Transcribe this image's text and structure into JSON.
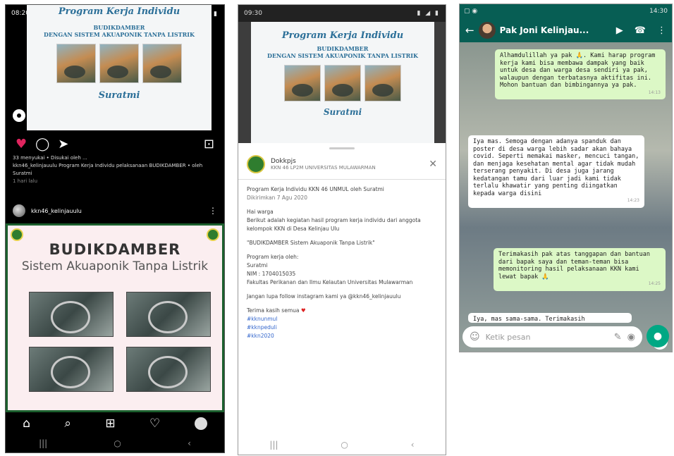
{
  "instagram": {
    "status_bar": {
      "time": "08:20",
      "right": "▮ ⌔ ◢ ▮"
    },
    "post_top": {
      "title": "Program Kerja Individu",
      "line1": "BUDIKDAMBER",
      "line2": "DENGAN SISTEM AKUAPONIK TANPA LISTRIK",
      "name": "Suratmi"
    },
    "likes_text": "33 menyukai • Disukai oleh ...",
    "caption_text": "kkn46_kelinjauulu Program Kerja Individu pelaksanaan BUDIKDAMBER • oleh Suratmi",
    "date_text": "1 hari lalu",
    "username": "kkn46_kelinjauulu",
    "post_bottom": {
      "title": "BUDIKDAMBER",
      "subtitle": "Sistem Akuaponik Tanpa Listrik"
    },
    "icons": {
      "heart": "♥",
      "comment": "◯",
      "share": "➤",
      "save": "⊡",
      "home": "⌂",
      "search": "⌕",
      "add": "⊞",
      "activity": "♡",
      "sys_recent": "|||",
      "sys_home": "○",
      "sys_back": "‹"
    }
  },
  "email": {
    "status_bar": {
      "time": "09:30",
      "right": "▮ ◢ ▮"
    },
    "post_top": {
      "title": "Program Kerja Individu",
      "line1": "BUDIKDAMBER",
      "line2": "DENGAN SISTEM AKUAPONIK TANPA LISTRIK",
      "name": "Suratmi"
    },
    "sender_name": "Dokkpjs",
    "sender_addr": "KKN 46 LP2M UNIVERSITAS MULAWARMAN",
    "close_icon": "✕",
    "subject": "Program Kerja Individu KKN 46 UNMUL oleh Suratmi",
    "sent_date": "Dikirimkan 7 Agu 2020",
    "greeting": "Hai warga",
    "intro": "Berikut adalah kegiatan hasil program kerja individu dari anggota kelompok KKN di Desa Kelinjau Ulu",
    "quote": "\"BUDIKDAMBER Sistem Akuaponik Tanpa Listrik\"",
    "by_label": "Program kerja oleh:",
    "member_name": "Suratmi",
    "nim": "NIM : 1704015035",
    "faculty": "Fakultas Perikanan dan Ilmu Kelautan Universitas Mulawarman",
    "cta": "Jangan lupa follow instagram kami ya @kkn46_kelinjauulu",
    "closing": "Terima kasih semua",
    "closing_icon": "♥",
    "tag1": "#kknunmul",
    "tag2": "#kknpeduli",
    "tag3": "#kkn2020",
    "nav": {
      "recent": "|||",
      "home": "○",
      "back": "‹"
    }
  },
  "whatsapp": {
    "status_bar": {
      "left": "▢ ◉",
      "right": "14:30"
    },
    "contact_name": "Pak Joni Kelinjau...",
    "icons": {
      "back": "←",
      "video": "▶",
      "call": "☎",
      "menu": "⋮",
      "emoji": "☺",
      "attach": "✎",
      "camera": "◉",
      "mic": "●",
      "scroll_down": "⌄"
    },
    "messages": [
      {
        "text": "Alhamdulillah ya pak 🙏. Kami harap program kerja kami bisa membawa dampak yang baik untuk desa dan warga desa sendiri ya pak, walaupun dengan terbatasnya aktifitas ini. Mohon bantuan dan bimbingannya ya pak.",
        "time": "14:13"
      },
      {
        "text": "Iya mas. Semoga dengan adanya spanduk dan poster di desa warga lebih sadar akan bahaya covid. Seperti memakai masker, mencuci tangan, dan menjaga kesehatan mental agar tidak mudah terserang penyakit. Di desa juga jarang kedatangan tamu dari luar jadi kami tidak terlalu khawatir yang penting diingatkan kepada warga disini",
        "time": "14:23"
      },
      {
        "text": "Terimakasih pak atas tanggapan dan bantuan dari bapak saya dan teman-teman bisa memonitoring hasil pelaksanaan KKN kami lewat bapak 🙏",
        "time": "14:25"
      },
      {
        "text": "Iya, mas sama-sama. Terimakasih",
        "time": ""
      }
    ],
    "input_placeholder": "Ketik pesan"
  }
}
